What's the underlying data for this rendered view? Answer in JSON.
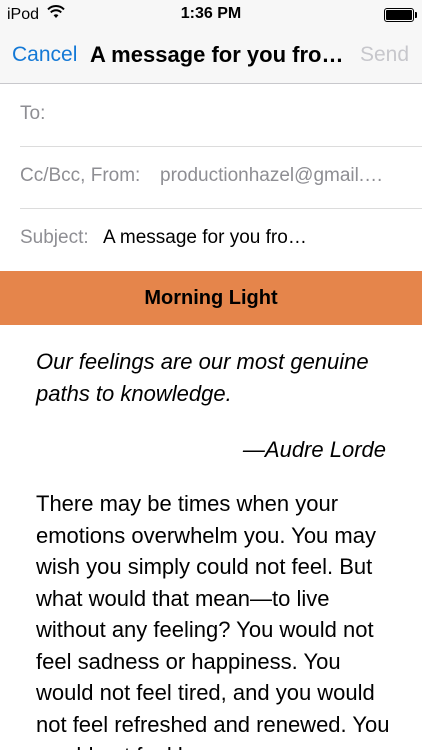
{
  "status_bar": {
    "device": "iPod",
    "time": "1:36 PM",
    "icons": {
      "wifi": "wifi-icon",
      "battery": "battery-icon"
    },
    "battery_level": 1.0
  },
  "nav": {
    "cancel_label": "Cancel",
    "title": "A message for you fro…",
    "send_label": "Send"
  },
  "fields": {
    "to_label": "To:",
    "to_value": "",
    "cc_label": "Cc/Bcc, From:",
    "cc_value": "productionhazel@gmail.…",
    "subject_label": "Subject:",
    "subject_value": "A message for you fro…"
  },
  "message": {
    "banner_title": "Morning Light",
    "banner_color": "#e5854b",
    "quote": "Our feelings are our most genuine paths to knowledge.",
    "author": "—Audre Lorde",
    "body": "There may be times when your emotions overwhelm you. You may wish you simply could not feel. But what would that mean—to live without any feeling? You would not feel sadness or happiness. You would not feel tired, and you would not feel refreshed and renewed. You would not feel love"
  },
  "colors": {
    "accent": "#1479d6",
    "disabled": "#c7c7cc",
    "label_gray": "#8e8e93"
  }
}
